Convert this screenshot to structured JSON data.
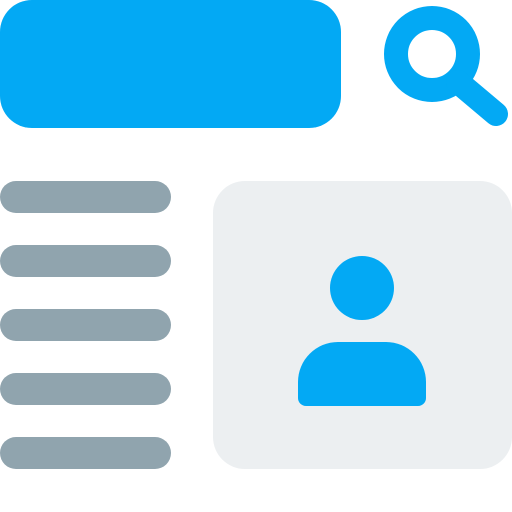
{
  "colors": {
    "accent": "#03A9F4",
    "muted": "#90A4AE",
    "card_bg": "#ECEFF1",
    "background": "#FFFFFF"
  },
  "header": {
    "search_bar": {
      "value": ""
    },
    "search_button_icon": "search-icon"
  },
  "list": {
    "count": 5
  },
  "profile_card": {
    "icon": "user-icon"
  }
}
